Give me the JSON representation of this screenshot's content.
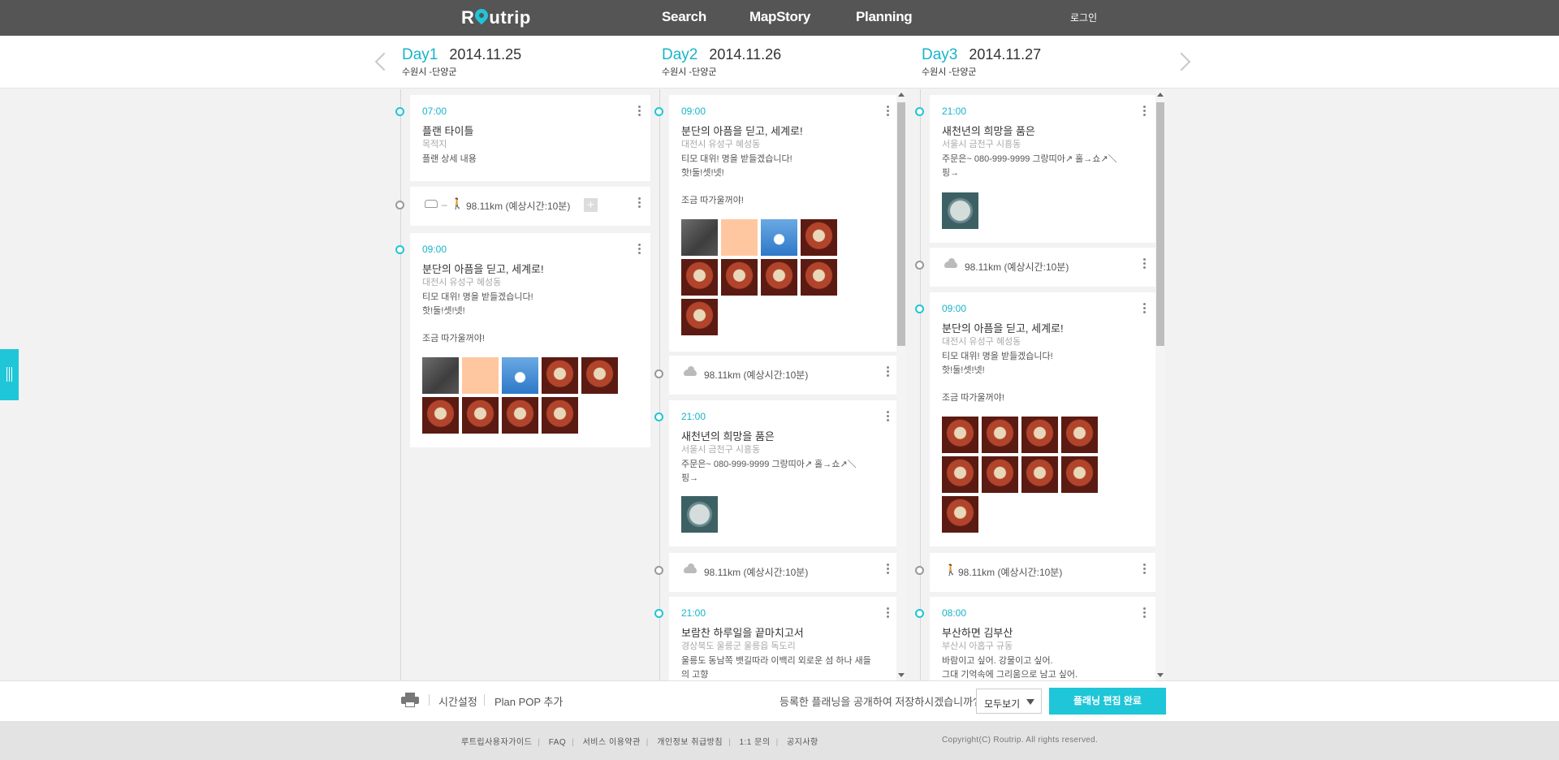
{
  "header": {
    "logo": "Routrip",
    "nav": [
      "Search",
      "MapStory",
      "Planning"
    ],
    "login": "로그인"
  },
  "days": [
    {
      "label": "Day1",
      "date": "2014.11.25",
      "route": "수원시 -단양군"
    },
    {
      "label": "Day2",
      "date": "2014.11.26",
      "route": "수원시 -단양군"
    },
    {
      "label": "Day3",
      "date": "2014.11.27",
      "route": "수원시 -단양군"
    }
  ],
  "col1": {
    "plan1": {
      "time": "07:00",
      "title": "플랜 타이틀",
      "loc": "목적지",
      "desc": "플랜 상세 내용"
    },
    "move1": {
      "text": "98.11km (예상시간:10분)",
      "sep": "–"
    },
    "plan2": {
      "time": "09:00",
      "title": "분단의 아픔을 딛고, 세계로!",
      "loc": "대전시 유성구 혜성동",
      "desc": "티모 대위! 명을 받들겠습니다!\n핫!둘!셋!넷!\n\n조금 따가울꺼야!"
    }
  },
  "col2": {
    "plan1": {
      "time": "09:00",
      "title": "분단의 아픔을 딛고, 세계로!",
      "loc": "대전시 유성구 혜성동",
      "desc": "티모 대위! 명을 받들겠습니다!\n핫!둘!셋!넷!\n\n조금 따가울꺼야!"
    },
    "move1": {
      "text": "98.11km (예상시간:10분)"
    },
    "plan2": {
      "time": "21:00",
      "title": "새천년의 희망을 품은",
      "loc": "서울시 금천구 시흥동",
      "desc": "주문은~ 080-999-9999 그랑띠아↗ 홀→쇼↗＼\n핑→"
    },
    "move2": {
      "text": "98.11km (예상시간:10분)"
    },
    "plan3": {
      "time": "21:00",
      "title": "보람찬 하루일을 끝마치고서",
      "loc": "경상북도 울릉군 울릉읍 독도리",
      "desc": "울릉도 동남쪽 뱃길따라 이백리 외로운 섬 하나 새들\n의 고향"
    }
  },
  "col3": {
    "plan1": {
      "time": "21:00",
      "title": "새천년의 희망을 품은",
      "loc": "서울시 금천구 시흥동",
      "desc": "주문은~ 080-999-9999 그랑띠아↗ 홀→쇼↗＼\n핑→"
    },
    "move1": {
      "text": "98.11km (예상시간:10분)"
    },
    "plan2": {
      "time": "09:00",
      "title": "분단의 아픔을 딛고, 세계로!",
      "loc": "대전시 유성구 혜성동",
      "desc": "티모 대위! 명을 받들겠습니다!\n핫!둘!셋!넷!\n\n조금 따가울꺼야!"
    },
    "move2": {
      "text": "98.11km (예상시간:10분)"
    },
    "plan3": {
      "time": "08:00",
      "title": "부산하면 김부산",
      "loc": "부산시 아홉구 규동",
      "desc": "바람이고 싶어. 강물이고 싶어.\n그대 기억속에 그리움으로 남고 싶어."
    }
  },
  "toolbar": {
    "time_setting": "시간설정",
    "plan_pop": "Plan POP 추가",
    "question": "등록한 플래닝을 공개하여 저장하시겠습니까?",
    "select_value": "모두보기",
    "done": "플래닝 편집 완료"
  },
  "footer": {
    "links": [
      "루트립사용자가이드",
      "FAQ",
      "서비스 이용약관",
      "개인정보 취급방침",
      "1:1 문의",
      "공지사항"
    ],
    "copyright": "Copyright(C) Routrip. All rights reserved."
  },
  "colors": {
    "accent": "#1ec6d8",
    "topbar": "#555555"
  }
}
